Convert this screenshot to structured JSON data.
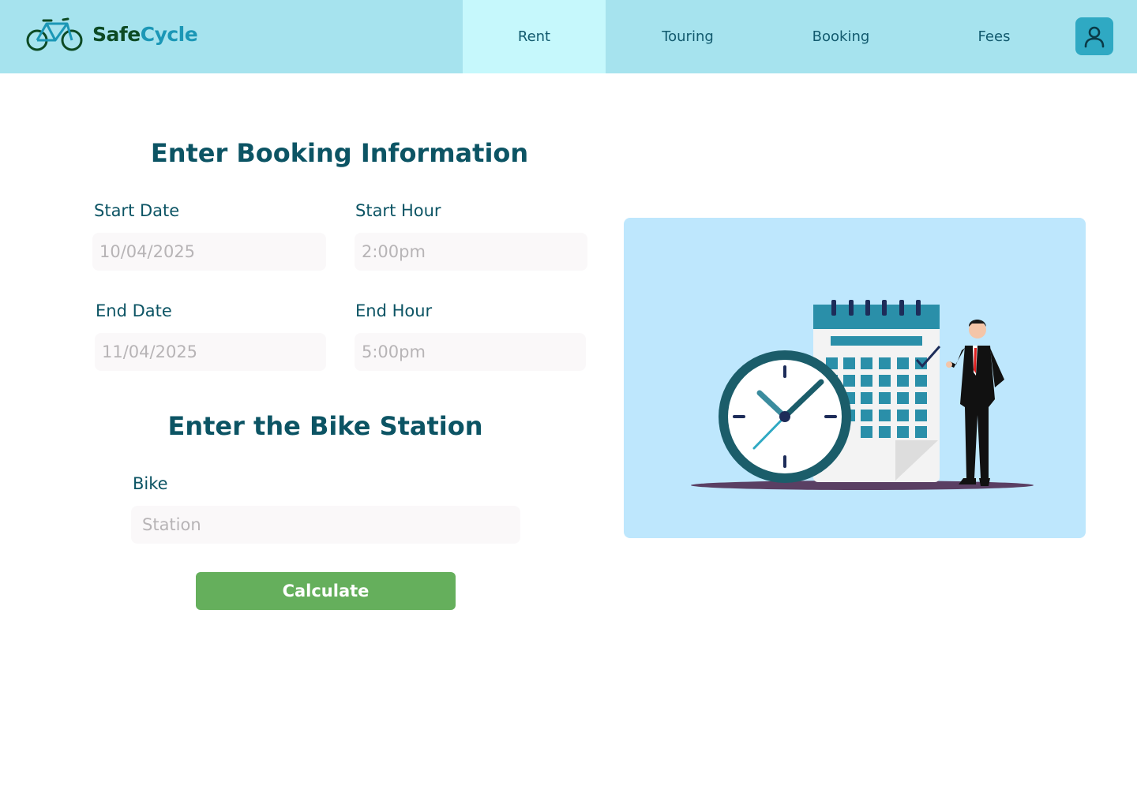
{
  "brand": {
    "name_part1": "Safe",
    "name_part2": "Cycle",
    "logo_icon": "bicycle-icon"
  },
  "nav": {
    "items": [
      {
        "label": "Rent",
        "active": true
      },
      {
        "label": "Touring",
        "active": false
      },
      {
        "label": "Booking",
        "active": false
      },
      {
        "label": "Fees",
        "active": false
      }
    ],
    "user_icon": "user-icon"
  },
  "booking": {
    "title": "Enter Booking Information",
    "start_date": {
      "label": "Start Date",
      "placeholder": "10/04/2025"
    },
    "start_hour": {
      "label": "Start Hour",
      "placeholder": "2:00pm"
    },
    "end_date": {
      "label": "End Date",
      "placeholder": "11/04/2025"
    },
    "end_hour": {
      "label": "End Hour",
      "placeholder": "5:00pm"
    }
  },
  "station": {
    "title": "Enter the Bike Station",
    "bike": {
      "label": "Bike",
      "placeholder": "Station"
    }
  },
  "actions": {
    "calculate_label": "Calculate"
  },
  "colors": {
    "header_bg": "#a6e3ee",
    "nav_active_bg": "#c6f8fc",
    "heading": "#0c5464",
    "button_green": "#65af5c",
    "illustration_bg": "#bee7fd"
  }
}
